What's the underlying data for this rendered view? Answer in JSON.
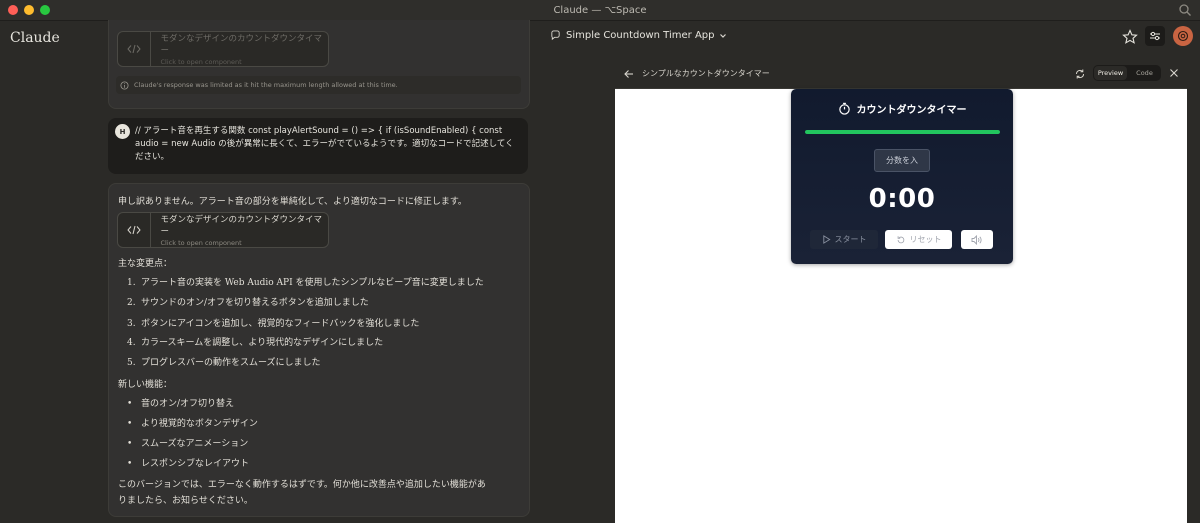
{
  "window": {
    "title": "Claude — ⌥Space"
  },
  "app": {
    "brand": "Claude",
    "project_title": "Simple Countdown Timer App"
  },
  "chat": {
    "prev_artifact": {
      "title": "モダンなデザインのカウントダウンタイマー",
      "subtitle": "Click to open component"
    },
    "limit_notice": "Claude's response was limited as it hit the maximum length allowed at this time.",
    "user_avatar": "H",
    "user_message": "// アラート音を再生する関数 const playAlertSound = () => { if (isSoundEnabled) { const audio = new Audio の後が異常に長くて、エラーがでているようです。適切なコードで記述してください。",
    "response": {
      "intro": "申し訳ありません。アラート音の部分を単純化して、より適切なコードに修正します。",
      "artifact": {
        "title": "モダンなデザインのカウントダウンタイマー",
        "subtitle": "Click to open component"
      },
      "changes_heading": "主な変更点：",
      "changes": [
        "アラート音の実装を Web Audio API を使用したシンプルなビープ音に変更しました",
        "サウンドのオン/オフを切り替えるボタンを追加しました",
        "ボタンにアイコンを追加し、視覚的なフィードバックを強化しました",
        "カラースキームを調整し、より現代的なデザインにしました",
        "プログレスバーの動作をスムーズにしました"
      ],
      "features_heading": "新しい機能：",
      "features": [
        "音のオン/オフ切り替え",
        "より視覚的なボタンデザイン",
        "スムーズなアニメーション",
        "レスポンシブなレイアウト"
      ],
      "closing_line1": "このバージョンでは、エラーなく動作するはずです。何か他に改善点や追加したい機能があ",
      "closing_line2": "りましたら、お知らせください。"
    }
  },
  "panel": {
    "title": "シンプルなカウントダウンタイマー",
    "tabs": [
      "Preview",
      "Code"
    ],
    "active_tab": "Preview"
  },
  "timer": {
    "title": "カウントダウンタイマー",
    "input_placeholder": "分数を入",
    "display": "0:00",
    "progress_fraction": 1.0,
    "start_label": "スタート",
    "reset_label": "リセット",
    "progress_color": "#22c55e"
  },
  "icons": {
    "back": "arrow-left-icon",
    "refresh": "refresh-icon",
    "close": "close-icon",
    "star": "star-icon",
    "settings": "sliders-icon",
    "code": "code-icon",
    "timer": "stopwatch-icon",
    "play": "play-icon",
    "reset": "reset-icon",
    "sound": "speaker-icon"
  }
}
